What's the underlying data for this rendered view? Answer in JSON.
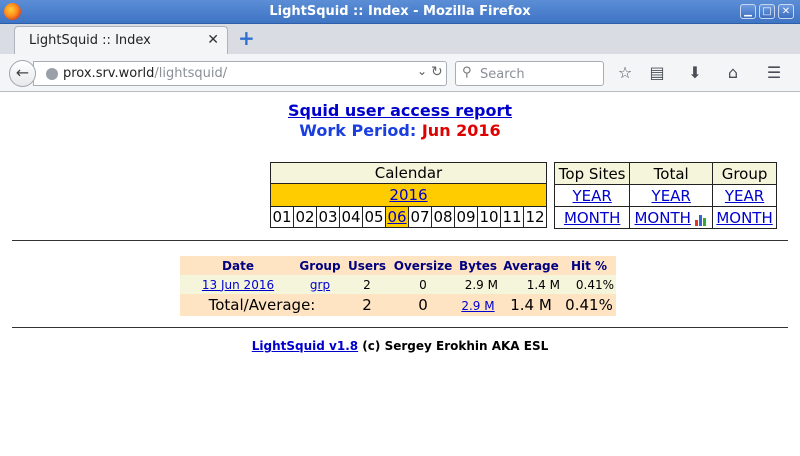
{
  "window": {
    "title": "LightSquid :: Index - Mozilla Firefox"
  },
  "tabs": [
    {
      "label": "LightSquid :: Index"
    }
  ],
  "nav": {
    "url_host": "prox.srv.world",
    "url_path": "/lightsquid/",
    "search_placeholder": "Search"
  },
  "report": {
    "title": "Squid user access report",
    "work_period_label": "Work Period:",
    "work_period_value": "Jun 2016"
  },
  "calendar": {
    "header": "Calendar",
    "year": "2016",
    "months": [
      "01",
      "02",
      "03",
      "04",
      "05",
      "06",
      "07",
      "08",
      "09",
      "10",
      "11",
      "12"
    ],
    "selected_month": "06"
  },
  "top_links": {
    "headers": [
      "Top Sites",
      "Total",
      "Group"
    ],
    "year_links": [
      "YEAR",
      "YEAR",
      "YEAR"
    ],
    "month_links": [
      "MONTH",
      "MONTH",
      "MONTH"
    ]
  },
  "stats": {
    "headers": [
      "Date",
      "Group",
      "Users",
      "Oversize",
      "Bytes",
      "Average",
      "Hit %"
    ],
    "row": {
      "date": "13 Jun 2016",
      "group": "grp",
      "users": "2",
      "oversize": "0",
      "bytes": "2.9 M",
      "average": "1.4 M",
      "hit": "0.41%"
    },
    "total": {
      "label": "Total/Average:",
      "users": "2",
      "oversize": "0",
      "bytes": "2.9 M",
      "average": "1.4 M",
      "hit": "0.41%"
    }
  },
  "footer": {
    "link": "LightSquid v1.8",
    "text": " (c) Sergey Erokhin AKA ESL"
  },
  "colors": {
    "titlebar": "#3f74c4",
    "calendar_header": "#f5f5dc",
    "highlight": "#ffcc00",
    "stats_header": "#ffe4c4",
    "link": "#0000cc",
    "period_value": "#e00000"
  }
}
